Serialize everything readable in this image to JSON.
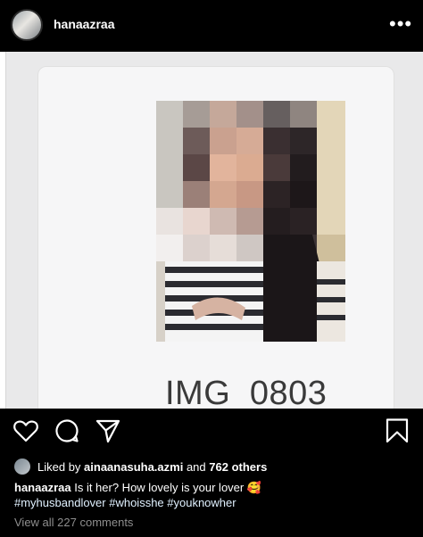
{
  "post": {
    "username": "hanaazraa",
    "more_icon": "more-dots-icon",
    "image_filename": "IMG_0803"
  },
  "actions": {
    "icons": [
      "heart-icon",
      "comment-icon",
      "share-icon",
      "bookmark-icon"
    ]
  },
  "likes": {
    "prefix": "Liked by",
    "user": "ainaanasuha.azmi",
    "and": "and",
    "others": "762 others"
  },
  "caption": {
    "username": "hanaazraa",
    "text": "Is it her? How lovely is your lover 🥰",
    "hashtags": "#myhusbandlover #whoisshe #youknowher"
  },
  "comments": {
    "view_all": "View all 227 comments"
  },
  "colors": {
    "background": "#000000",
    "hashtag": "#e0f1ff",
    "muted": "#8e8e8e"
  }
}
